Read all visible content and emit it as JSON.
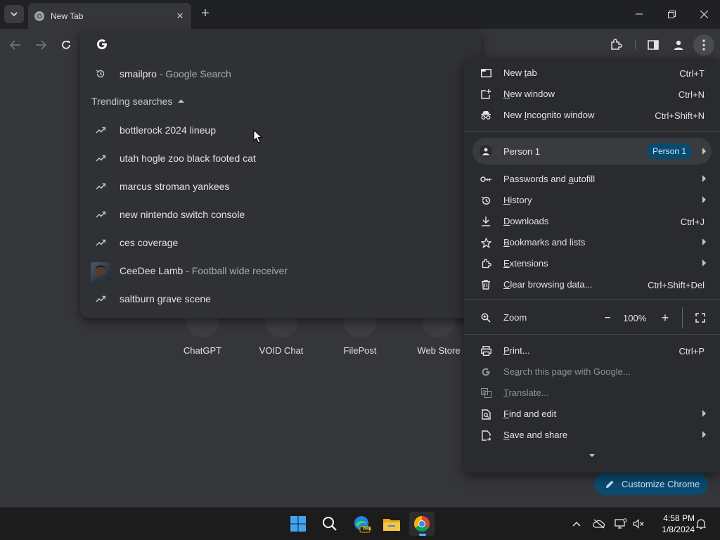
{
  "tab": {
    "title": "New Tab"
  },
  "omnibox": {
    "history": {
      "query": "smailpro",
      "suffix": " - Google Search"
    },
    "trending_header": "Trending searches",
    "trending": [
      {
        "text": "bottlerock 2024 lineup"
      },
      {
        "text": "utah hogle zoo black footed cat"
      },
      {
        "text": "marcus stroman yankees"
      },
      {
        "text": "new nintendo switch console"
      },
      {
        "text": "ces coverage"
      }
    ],
    "entity": {
      "text": "CeeDee Lamb",
      "suffix": " - Football wide receiver"
    },
    "last": {
      "text": "saltburn grave scene"
    }
  },
  "shortcuts": [
    {
      "label": "ChatGPT"
    },
    {
      "label": "VOID Chat"
    },
    {
      "label": "FilePost"
    },
    {
      "label": "Web Store"
    }
  ],
  "customize": {
    "label": "Customize Chrome"
  },
  "menu": {
    "new_tab": {
      "pre": "New ",
      "u": "t",
      "post": "ab",
      "shortcut": "Ctrl+T"
    },
    "new_window": {
      "pre": "",
      "u": "N",
      "post": "ew window",
      "shortcut": "Ctrl+N"
    },
    "new_incognito": {
      "pre": "New ",
      "u": "I",
      "post": "ncognito window",
      "shortcut": "Ctrl+Shift+N"
    },
    "person": {
      "label": "Person 1",
      "badge": "Person 1"
    },
    "passwords": {
      "pre": "Passwords and ",
      "u": "a",
      "post": "utofill"
    },
    "history": {
      "pre": "",
      "u": "H",
      "post": "istory"
    },
    "downloads": {
      "pre": "",
      "u": "D",
      "post": "ownloads",
      "shortcut": "Ctrl+J"
    },
    "bookmarks": {
      "pre": "",
      "u": "B",
      "post": "ookmarks and lists"
    },
    "extensions": {
      "pre": "",
      "u": "E",
      "post": "xtensions"
    },
    "clear": {
      "pre": "",
      "u": "C",
      "post": "lear browsing data...",
      "shortcut": "Ctrl+Shift+Del"
    },
    "zoom": {
      "label": "Zoom",
      "minus": "−",
      "value": "100%",
      "plus": "+"
    },
    "print": {
      "pre": "",
      "u": "P",
      "post": "rint...",
      "shortcut": "Ctrl+P"
    },
    "search_page": {
      "pre": "Se",
      "u": "a",
      "post": "rch this page with Google..."
    },
    "translate": {
      "pre": "",
      "u": "T",
      "post": "ranslate..."
    },
    "find_edit": {
      "pre": "",
      "u": "F",
      "post": "ind and edit"
    },
    "save_share": {
      "pre": "",
      "u": "S",
      "post": "ave and share"
    }
  },
  "taskbar": {
    "time": "4:58 PM",
    "date": "1/8/2024",
    "edge_badge": "PRE"
  },
  "colors": {
    "accent": "#0b4a70",
    "accent_text": "#c2e7ff",
    "menu_bg": "#2a2b2e",
    "page_bg": "#35363a"
  }
}
